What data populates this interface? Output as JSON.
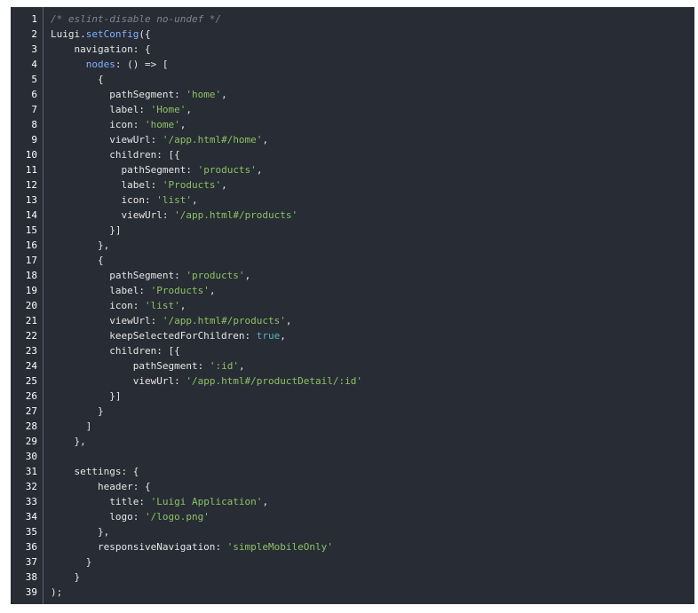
{
  "code_lines": [
    [
      {
        "t": "/* eslint-disable no-undef */",
        "c": "comment"
      }
    ],
    [
      {
        "t": "Luigi",
        "c": "plain"
      },
      {
        "t": ".",
        "c": "punc"
      },
      {
        "t": "setConfig",
        "c": "kw"
      },
      {
        "t": "({",
        "c": "punc"
      }
    ],
    [
      {
        "t": "    navigation",
        "c": "prop"
      },
      {
        "t": ": {",
        "c": "punc"
      }
    ],
    [
      {
        "t": "      nodes",
        "c": "kw"
      },
      {
        "t": ": () => [",
        "c": "punc"
      }
    ],
    [
      {
        "t": "        {",
        "c": "punc"
      }
    ],
    [
      {
        "t": "          pathSegment",
        "c": "prop"
      },
      {
        "t": ": ",
        "c": "punc"
      },
      {
        "t": "'home'",
        "c": "str"
      },
      {
        "t": ",",
        "c": "punc"
      }
    ],
    [
      {
        "t": "          label",
        "c": "prop"
      },
      {
        "t": ": ",
        "c": "punc"
      },
      {
        "t": "'Home'",
        "c": "str"
      },
      {
        "t": ",",
        "c": "punc"
      }
    ],
    [
      {
        "t": "          icon",
        "c": "prop"
      },
      {
        "t": ": ",
        "c": "punc"
      },
      {
        "t": "'home'",
        "c": "str"
      },
      {
        "t": ",",
        "c": "punc"
      }
    ],
    [
      {
        "t": "          viewUrl",
        "c": "prop"
      },
      {
        "t": ": ",
        "c": "punc"
      },
      {
        "t": "'/app.html#/home'",
        "c": "str"
      },
      {
        "t": ",",
        "c": "punc"
      }
    ],
    [
      {
        "t": "          children",
        "c": "prop"
      },
      {
        "t": ": [{",
        "c": "punc"
      }
    ],
    [
      {
        "t": "            pathSegment",
        "c": "prop"
      },
      {
        "t": ": ",
        "c": "punc"
      },
      {
        "t": "'products'",
        "c": "str"
      },
      {
        "t": ",",
        "c": "punc"
      }
    ],
    [
      {
        "t": "            label",
        "c": "prop"
      },
      {
        "t": ": ",
        "c": "punc"
      },
      {
        "t": "'Products'",
        "c": "str"
      },
      {
        "t": ",",
        "c": "punc"
      }
    ],
    [
      {
        "t": "            icon",
        "c": "prop"
      },
      {
        "t": ": ",
        "c": "punc"
      },
      {
        "t": "'list'",
        "c": "str"
      },
      {
        "t": ",",
        "c": "punc"
      }
    ],
    [
      {
        "t": "            viewUrl",
        "c": "prop"
      },
      {
        "t": ": ",
        "c": "punc"
      },
      {
        "t": "'/app.html#/products'",
        "c": "str"
      }
    ],
    [
      {
        "t": "          }]",
        "c": "punc"
      }
    ],
    [
      {
        "t": "        },",
        "c": "punc"
      }
    ],
    [
      {
        "t": "        {",
        "c": "punc"
      }
    ],
    [
      {
        "t": "          pathSegment",
        "c": "prop"
      },
      {
        "t": ": ",
        "c": "punc"
      },
      {
        "t": "'products'",
        "c": "str"
      },
      {
        "t": ",",
        "c": "punc"
      }
    ],
    [
      {
        "t": "          label",
        "c": "prop"
      },
      {
        "t": ": ",
        "c": "punc"
      },
      {
        "t": "'Products'",
        "c": "str"
      },
      {
        "t": ",",
        "c": "punc"
      }
    ],
    [
      {
        "t": "          icon",
        "c": "prop"
      },
      {
        "t": ": ",
        "c": "punc"
      },
      {
        "t": "'list'",
        "c": "str"
      },
      {
        "t": ",",
        "c": "punc"
      }
    ],
    [
      {
        "t": "          viewUrl",
        "c": "prop"
      },
      {
        "t": ": ",
        "c": "punc"
      },
      {
        "t": "'/app.html#/products'",
        "c": "str"
      },
      {
        "t": ",",
        "c": "punc"
      }
    ],
    [
      {
        "t": "          keepSelectedForChildren",
        "c": "prop"
      },
      {
        "t": ": ",
        "c": "punc"
      },
      {
        "t": "true",
        "c": "num"
      },
      {
        "t": ",",
        "c": "punc"
      }
    ],
    [
      {
        "t": "          children",
        "c": "prop"
      },
      {
        "t": ": [{",
        "c": "punc"
      }
    ],
    [
      {
        "t": "              pathSegment",
        "c": "prop"
      },
      {
        "t": ": ",
        "c": "punc"
      },
      {
        "t": "':id'",
        "c": "str"
      },
      {
        "t": ",",
        "c": "punc"
      }
    ],
    [
      {
        "t": "              viewUrl",
        "c": "prop"
      },
      {
        "t": ": ",
        "c": "punc"
      },
      {
        "t": "'/app.html#/productDetail/:id'",
        "c": "str"
      }
    ],
    [
      {
        "t": "          }]",
        "c": "punc"
      }
    ],
    [
      {
        "t": "        }",
        "c": "punc"
      }
    ],
    [
      {
        "t": "      ]",
        "c": "punc"
      }
    ],
    [
      {
        "t": "    },",
        "c": "punc"
      }
    ],
    [],
    [
      {
        "t": "    settings",
        "c": "prop"
      },
      {
        "t": ": {",
        "c": "punc"
      }
    ],
    [
      {
        "t": "        header",
        "c": "prop"
      },
      {
        "t": ": {",
        "c": "punc"
      }
    ],
    [
      {
        "t": "          title",
        "c": "prop"
      },
      {
        "t": ": ",
        "c": "punc"
      },
      {
        "t": "'Luigi Application'",
        "c": "str"
      },
      {
        "t": ",",
        "c": "punc"
      }
    ],
    [
      {
        "t": "          logo",
        "c": "prop"
      },
      {
        "t": ": ",
        "c": "punc"
      },
      {
        "t": "'/logo.png'",
        "c": "str"
      }
    ],
    [
      {
        "t": "        },",
        "c": "punc"
      }
    ],
    [
      {
        "t": "        responsiveNavigation",
        "c": "prop"
      },
      {
        "t": ": ",
        "c": "punc"
      },
      {
        "t": "'simpleMobileOnly'",
        "c": "str"
      }
    ],
    [
      {
        "t": "      }",
        "c": "punc"
      }
    ],
    [
      {
        "t": "    }",
        "c": "punc"
      }
    ],
    [
      {
        "t": ");",
        "c": "punc"
      }
    ]
  ],
  "line_numbers": [
    "1",
    "2",
    "3",
    "4",
    "5",
    "6",
    "7",
    "8",
    "9",
    "10",
    "11",
    "12",
    "13",
    "14",
    "15",
    "16",
    "17",
    "18",
    "19",
    "20",
    "21",
    "22",
    "23",
    "24",
    "25",
    "26",
    "27",
    "28",
    "29",
    "30",
    "31",
    "32",
    "33",
    "34",
    "35",
    "36",
    "37",
    "38",
    "39"
  ],
  "colors": {
    "background": "#282c34",
    "keyword": "#7fb2ff",
    "string": "#8cc265",
    "boolean": "#56b6c2",
    "comment": "#7f848e",
    "text": "#e6e6e6"
  }
}
